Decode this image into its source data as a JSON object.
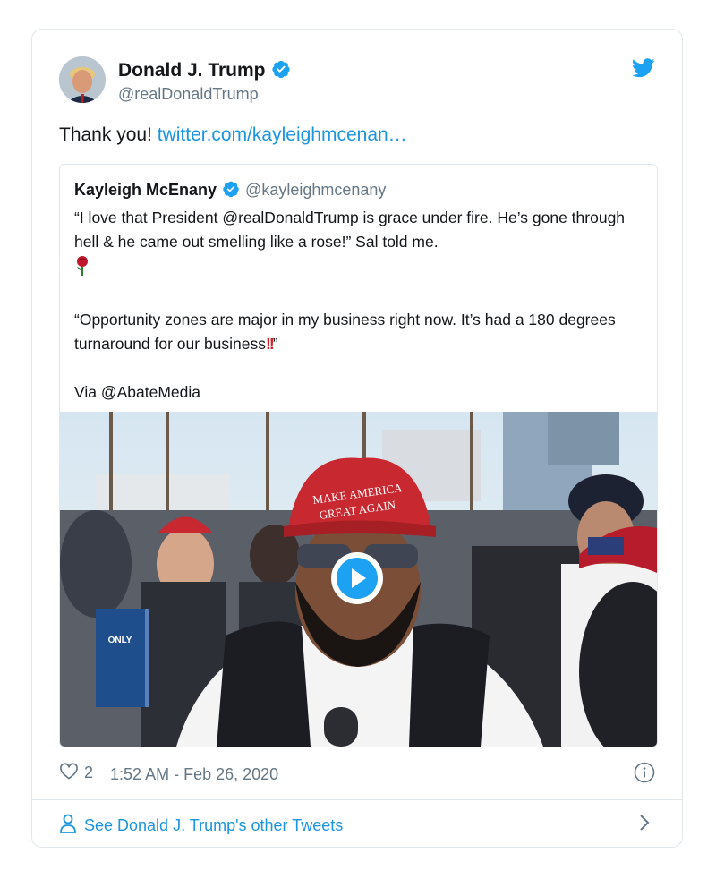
{
  "author": {
    "name": "Donald J. Trump",
    "handle": "@realDonaldTrump"
  },
  "tweet": {
    "text_prefix": "Thank you! ",
    "link": "twitter.com/kayleighmcenan…"
  },
  "quoted": {
    "name": "Kayleigh McEnany",
    "handle": "@kayleighmcenany",
    "line1": "“I love that President @realDonaldTrump is grace under fire. He’s gone through hell & he came out smelling like a rose!” Sal told me.",
    "line2_prefix": "“Opportunity zones are major in my business right now. It’s had a 180 degrees turnaround for our business",
    "line2_suffix": "”",
    "line3": "Via @AbateMedia",
    "hat_text": "MAKE AMERICA GREAT AGAIN",
    "sign_text": "ONLY"
  },
  "meta": {
    "likes": "2",
    "timestamp": "1:52 AM - Feb 26, 2020"
  },
  "footer": {
    "link_label": "See Donald J. Trump's other Tweets"
  },
  "colors": {
    "accent": "#1da1f2",
    "link": "#1b95e0",
    "muted": "#657786",
    "border": "#e1e8ed",
    "hat_red": "#c8282f"
  },
  "icons": [
    "verified-badge-icon",
    "twitter-bird-icon",
    "play-icon",
    "heart-icon",
    "info-icon",
    "person-icon",
    "chevron-right-icon",
    "rose-emoji-icon"
  ]
}
